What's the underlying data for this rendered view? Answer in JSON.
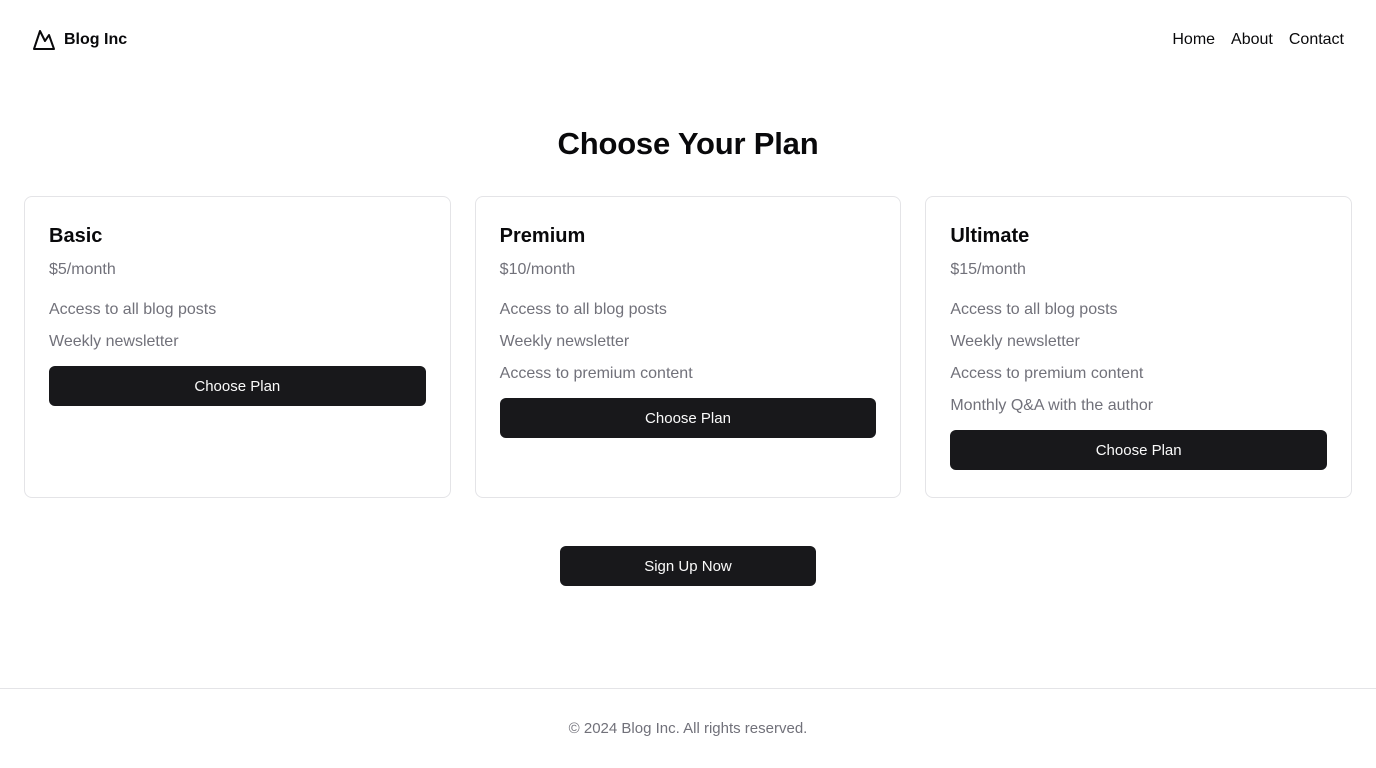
{
  "header": {
    "brand": "Blog Inc",
    "brand_icon": "mountain-icon",
    "nav": [
      {
        "label": "Home"
      },
      {
        "label": "About"
      },
      {
        "label": "Contact"
      }
    ]
  },
  "main": {
    "title": "Choose Your Plan",
    "plans": [
      {
        "name": "Basic",
        "price": "$5/month",
        "features": [
          "Access to all blog posts",
          "Weekly newsletter"
        ],
        "button": "Choose Plan"
      },
      {
        "name": "Premium",
        "price": "$10/month",
        "features": [
          "Access to all blog posts",
          "Weekly newsletter",
          "Access to premium content"
        ],
        "button": "Choose Plan"
      },
      {
        "name": "Ultimate",
        "price": "$15/month",
        "features": [
          "Access to all blog posts",
          "Weekly newsletter",
          "Access to premium content",
          "Monthly Q&A with the author"
        ],
        "button": "Choose Plan"
      }
    ],
    "signup_button": "Sign Up Now"
  },
  "footer": {
    "copyright": "© 2024 Blog Inc. All rights reserved."
  },
  "colors": {
    "primary": "#18181b",
    "muted_text": "#71717a",
    "border": "#e4e4e7"
  }
}
